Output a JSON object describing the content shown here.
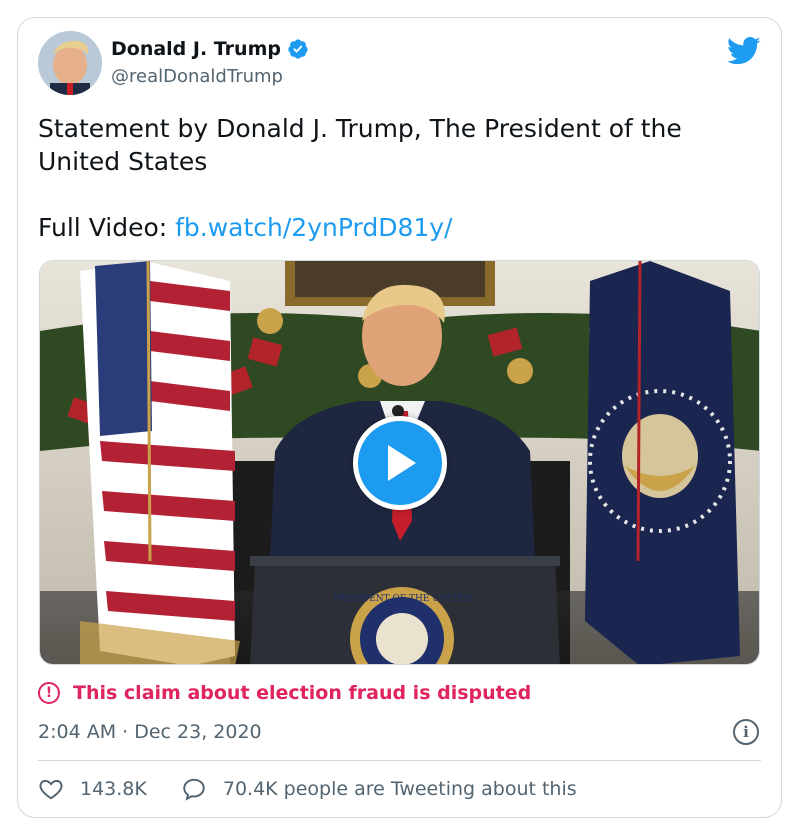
{
  "author": {
    "name": "Donald J. Trump",
    "handle": "@realDonaldTrump",
    "verified": true,
    "avatar_icon": "avatar-photo"
  },
  "tweet": {
    "line1": "Statement by Donald J. Trump, The President of the United States",
    "line2_prefix": "Full Video: ",
    "link_text": "fb.watch/2ynPrdD81y/"
  },
  "media": {
    "type": "video",
    "play_icon": "play-icon",
    "podium_seal_text": "PRESIDENT OF THE UNITED"
  },
  "label": {
    "text": "This claim about election fraud is disputed",
    "icon": "exclamation-circle-icon",
    "color": "#e0245e"
  },
  "meta": {
    "timestamp": "2:04 AM · Dec 23, 2020",
    "info_icon": "info-icon"
  },
  "actions": {
    "likes": "143.8K",
    "replies_text": "70.4K people are Tweeting about this"
  },
  "colors": {
    "accent": "#1d9bf0",
    "text": "#0f1419",
    "muted": "#536471",
    "border": "#cfd9de"
  }
}
